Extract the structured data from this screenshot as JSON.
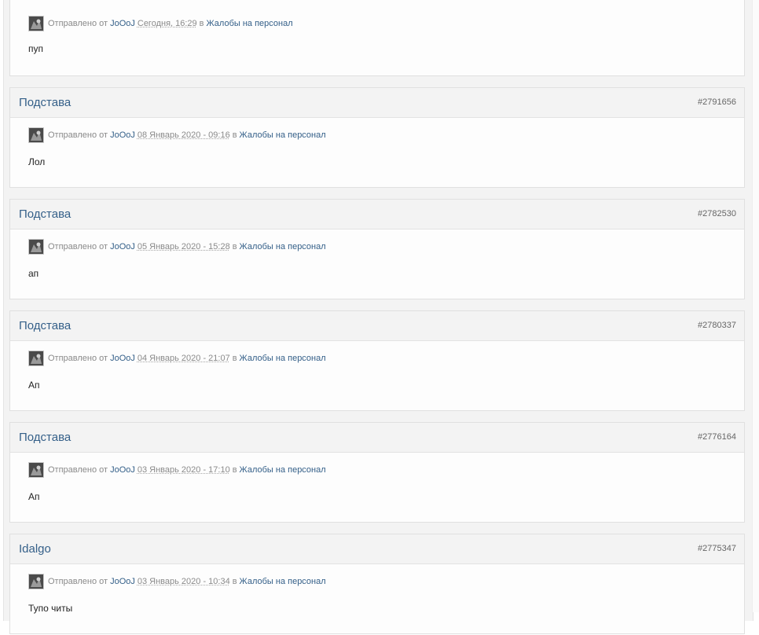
{
  "posts": [
    {
      "title": "",
      "id": "",
      "sent_label": "Отправлено от",
      "author": "JoOoJ",
      "date": "Сегодня, 16:29",
      "in_label": "в",
      "forum": "Жалобы на персонал",
      "content": "пуп"
    },
    {
      "title": "Подстава",
      "id": "#2791656",
      "sent_label": "Отправлено от",
      "author": "JoOoJ",
      "date": "08 Январь 2020 - 09:16",
      "in_label": "в",
      "forum": "Жалобы на персонал",
      "content": "Лол"
    },
    {
      "title": "Подстава",
      "id": "#2782530",
      "sent_label": "Отправлено от",
      "author": "JoOoJ",
      "date": "05 Январь 2020 - 15:28",
      "in_label": "в",
      "forum": "Жалобы на персонал",
      "content": "ап"
    },
    {
      "title": "Подстава",
      "id": "#2780337",
      "sent_label": "Отправлено от",
      "author": "JoOoJ",
      "date": "04 Январь 2020 - 21:07",
      "in_label": "в",
      "forum": "Жалобы на персонал",
      "content": "Ап"
    },
    {
      "title": "Подстава",
      "id": "#2776164",
      "sent_label": "Отправлено от",
      "author": "JoOoJ",
      "date": "03 Январь 2020 - 17:10",
      "in_label": "в",
      "forum": "Жалобы на персонал",
      "content": "Ап"
    },
    {
      "title": "Idalgo",
      "id": "#2775347",
      "sent_label": "Отправлено от",
      "author": "JoOoJ",
      "date": "03 Январь 2020 - 10:34",
      "in_label": "в",
      "forum": "Жалобы на персонал",
      "content": "Тупо читы"
    }
  ]
}
